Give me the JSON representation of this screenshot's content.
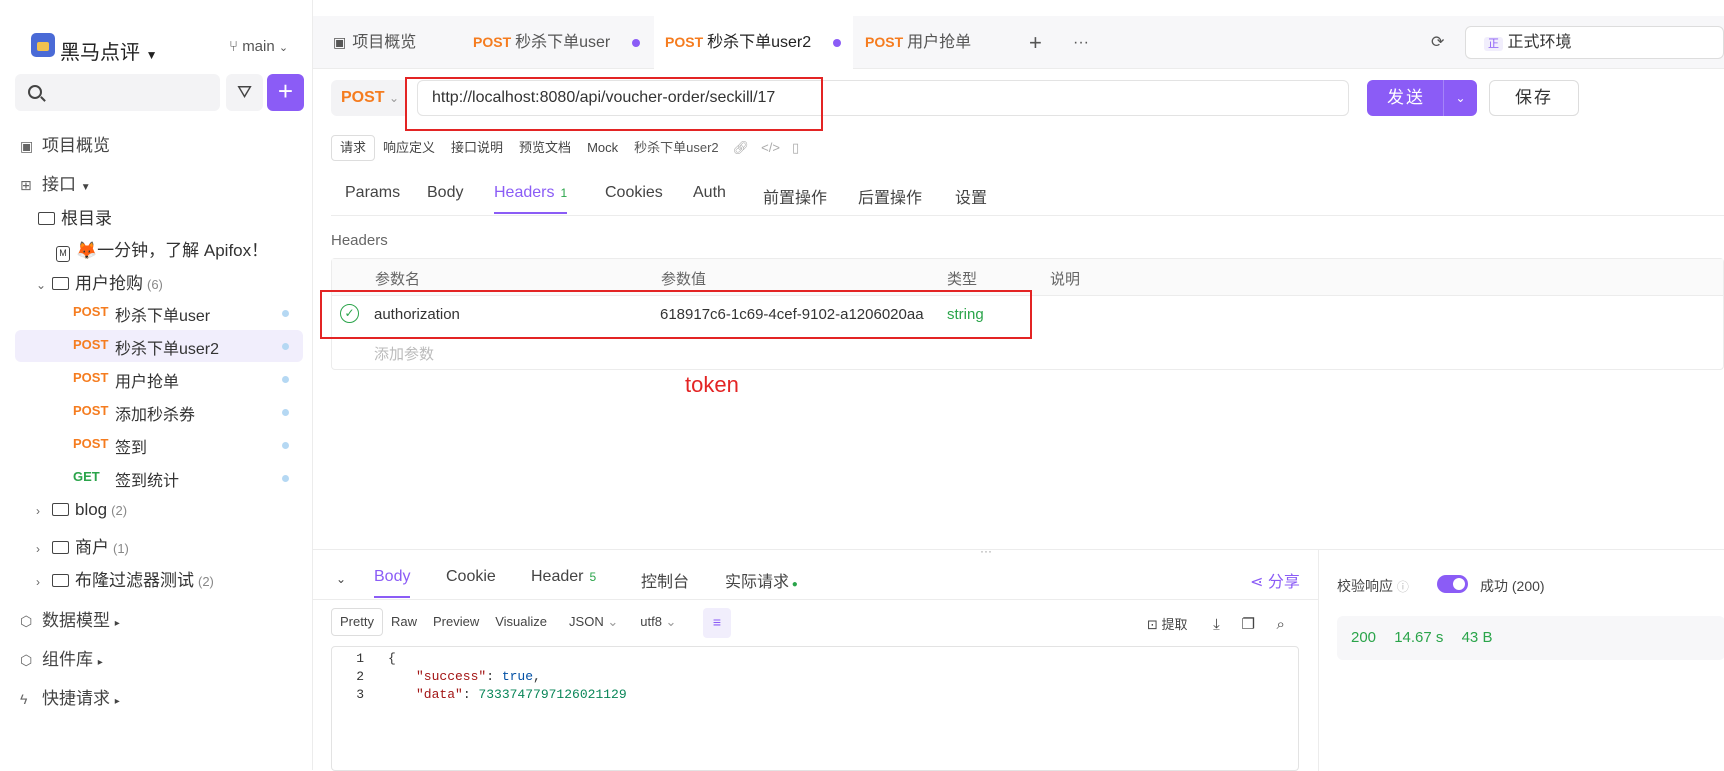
{
  "sidebar": {
    "title": "黑马点评",
    "branch": "main",
    "nav": {
      "overview": "项目概览",
      "api": "接口",
      "models": "数据模型",
      "components": "组件库",
      "quick": "快捷请求"
    },
    "tree": {
      "root": "根目录",
      "intro": "🦊一分钟，了解 Apifox！",
      "folder_user": {
        "label": "用户抢购",
        "count": "(6)"
      },
      "apis": [
        {
          "method": "POST",
          "name": "秒杀下单user"
        },
        {
          "method": "POST",
          "name": "秒杀下单user2"
        },
        {
          "method": "POST",
          "name": "用户抢单"
        },
        {
          "method": "POST",
          "name": "添加秒杀券"
        },
        {
          "method": "POST",
          "name": "签到"
        },
        {
          "method": "GET",
          "name": "签到统计"
        }
      ],
      "folders": [
        {
          "label": "blog",
          "count": "(2)"
        },
        {
          "label": "商户",
          "count": "(1)"
        },
        {
          "label": "布隆过滤器测试",
          "count": "(2)"
        }
      ]
    }
  },
  "tabs": {
    "overview": "项目概览",
    "items": [
      {
        "method": "POST",
        "name": "秒杀下单user"
      },
      {
        "method": "POST",
        "name": "秒杀下单user2"
      },
      {
        "method": "POST",
        "name": "用户抢单"
      }
    ],
    "add": "+",
    "more": "···",
    "env_badge": "正",
    "env": "正式环境"
  },
  "request": {
    "method": "POST",
    "url": "http://localhost:8080/api/voucher-order/seckill/17",
    "send": "发送",
    "save": "保存",
    "subtabs": [
      "请求",
      "响应定义",
      "接口说明",
      "预览文档",
      "Mock"
    ],
    "api_name": "秒杀下单user2",
    "tabs": {
      "params": "Params",
      "body": "Body",
      "headers": "Headers",
      "headers_count": "1",
      "cookies": "Cookies",
      "auth": "Auth",
      "pre": "前置操作",
      "post": "后置操作",
      "settings": "设置"
    },
    "headers_label": "Headers",
    "columns": [
      "参数名",
      "参数值",
      "类型",
      "说明"
    ],
    "header_row": {
      "name": "authorization",
      "value": "618917c6-1c69-4cef-9102-a1206020aa",
      "type": "string"
    },
    "add_param": "添加参数",
    "annotation": "token"
  },
  "response": {
    "tabs": {
      "body": "Body",
      "cookie": "Cookie",
      "header": "Header",
      "header_count": "5",
      "console": "控制台",
      "actual": "实际请求"
    },
    "share": "分享",
    "formats": [
      "Pretty",
      "Raw",
      "Preview",
      "Visualize"
    ],
    "type": "JSON",
    "encoding": "utf8",
    "tools": {
      "extract": "提取"
    },
    "code": [
      {
        "line": "1",
        "text": "{"
      },
      {
        "line": "2",
        "key": "\"success\"",
        "value": "true"
      },
      {
        "line": "3",
        "key": "\"data\"",
        "value": "7333747797126021129"
      }
    ],
    "verify_label": "校验响应",
    "verify_result": "成功 (200)",
    "status": "200",
    "time": "14.67 s",
    "size": "43 B"
  }
}
